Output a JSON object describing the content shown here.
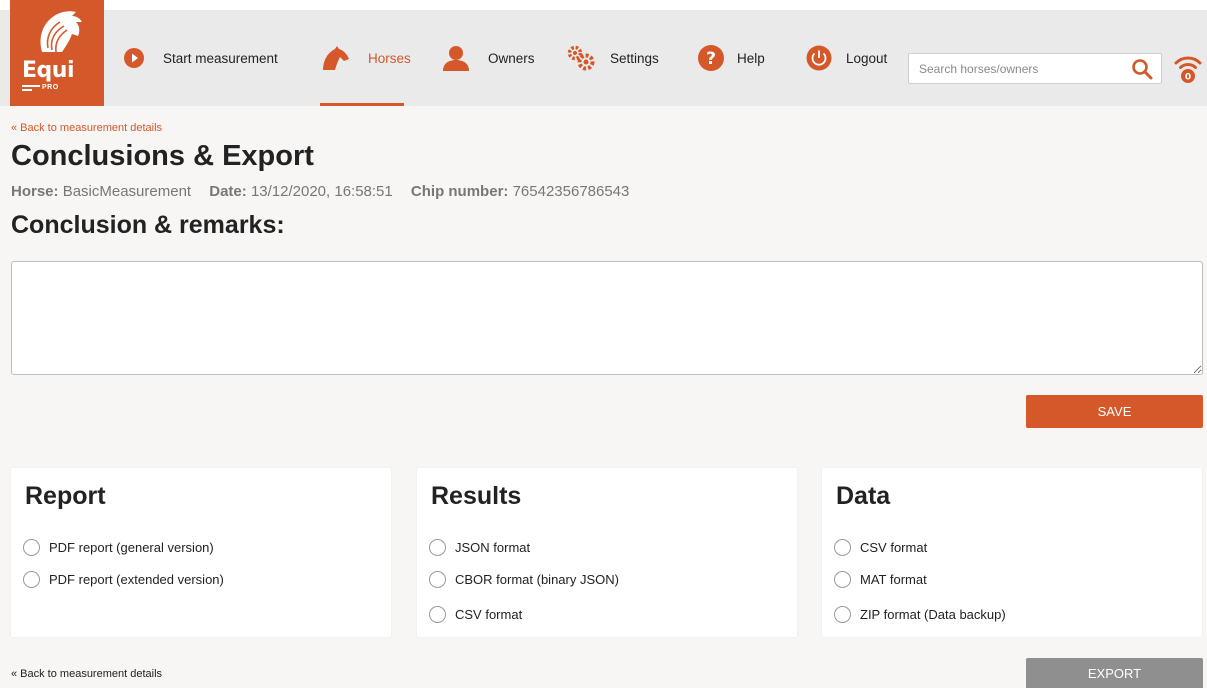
{
  "app": {
    "brand": "Equi",
    "brand_sub": "PRO"
  },
  "nav": {
    "items": [
      {
        "label": "Start measurement",
        "icon": "play-circle-icon"
      },
      {
        "label": "Horses",
        "icon": "horse-head-icon",
        "active": true
      },
      {
        "label": "Owners",
        "icon": "person-icon"
      },
      {
        "label": "Settings",
        "icon": "gears-icon"
      },
      {
        "label": "Help",
        "icon": "question-circle-icon"
      },
      {
        "label": "Logout",
        "icon": "power-icon"
      }
    ],
    "search_placeholder": "Search horses/owners",
    "search_value": "",
    "wifi_count": "0"
  },
  "page": {
    "back_link": "« Back to measurement details",
    "title": "Conclusions & Export",
    "meta": {
      "horse_label": "Horse:",
      "horse_value": "BasicMeasurement",
      "date_label": "Date:",
      "date_value": "13/12/2020, 16:58:51",
      "chip_label": "Chip number:",
      "chip_value": "76542356786543"
    },
    "remarks_title": "Conclusion & remarks:",
    "remarks_value": "",
    "save_label": "SAVE",
    "export_label": "EXPORT"
  },
  "cards": [
    {
      "title": "Report",
      "options": [
        "PDF report (general version)",
        "PDF report (extended version)"
      ]
    },
    {
      "title": "Results",
      "options": [
        "JSON format",
        "CBOR format (binary JSON)",
        "CSV format"
      ]
    },
    {
      "title": "Data",
      "options": [
        "CSV format",
        "MAT format",
        "ZIP format (Data backup)"
      ]
    }
  ],
  "colors": {
    "accent": "#d4582a",
    "navbar_bg": "#ebeaea",
    "page_bg": "#f7f6f4",
    "export_btn": "#8f8f8f"
  }
}
